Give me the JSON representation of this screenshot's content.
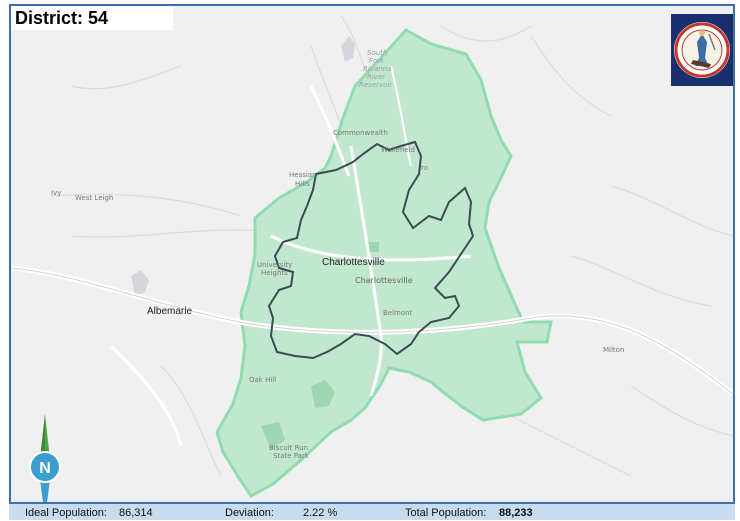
{
  "district": {
    "label": "District: 54"
  },
  "seal": {
    "icon": "virginia-state-seal-icon",
    "bg_color": "#1a2f6e"
  },
  "map": {
    "district_fill": "#b8e6c9",
    "district_stroke": "#8fdcae",
    "city_stroke": "#3e4a55",
    "places": {
      "charlottesville_city": "Charlottesville",
      "charlottesville": "Charlottesville",
      "albemarle": "Albemarle",
      "west_leigh": "West Leigh",
      "ivy": "Ivy",
      "milton": "Milton",
      "hessian_hills_1": "Hessian",
      "hessian_hills_2": "Hills",
      "commonwealth": "Commonwealth",
      "wakefield": "Wakefield",
      "university_heights_1": "University",
      "university_heights_2": "Heights",
      "belmont": "Belmont",
      "oak_hill": "Oak Hill",
      "biscuit_run_1": "Biscuit Run",
      "biscuit_run_2": "State Park",
      "reservoir_1": "South",
      "reservoir_2": "Fork",
      "reservoir_3": "Rivanna",
      "reservoir_4": "River",
      "reservoir_5": "Reservoir",
      "ro": "ro"
    }
  },
  "compass": {
    "icon": "north-arrow-icon",
    "letter": "N"
  },
  "footer": {
    "ideal_label": "Ideal Population:",
    "ideal_value": "86,314",
    "deviation_label": "Deviation:",
    "deviation_value": "2.22 %",
    "total_label": "Total Population:",
    "total_value": "88,233"
  }
}
